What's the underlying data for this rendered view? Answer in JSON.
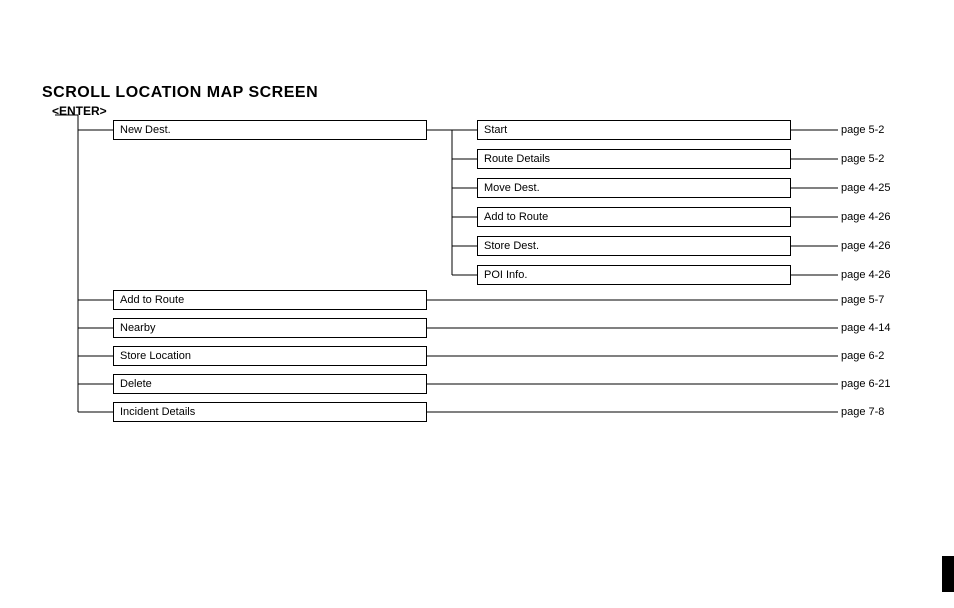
{
  "title": "SCROLL LOCATION MAP SCREEN",
  "subtitle": "<ENTER>",
  "level1": [
    {
      "label": "New Dest.",
      "page": ""
    },
    {
      "label": "Add to Route",
      "page": "page 5-7"
    },
    {
      "label": "Nearby",
      "page": "page 4-14"
    },
    {
      "label": "Store Location",
      "page": "page 6-2"
    },
    {
      "label": "Delete",
      "page": "page 6-21"
    },
    {
      "label": "Incident Details",
      "page": "page 7-8"
    }
  ],
  "level2": [
    {
      "label": "Start",
      "page": "page 5-2"
    },
    {
      "label": "Route Details",
      "page": "page 5-2"
    },
    {
      "label": "Move Dest.",
      "page": "page 4-25"
    },
    {
      "label": "Add to Route",
      "page": "page 4-26"
    },
    {
      "label": "Store Dest.",
      "page": "page 4-26"
    },
    {
      "label": "POI Info.",
      "page": "page 4-26"
    }
  ]
}
